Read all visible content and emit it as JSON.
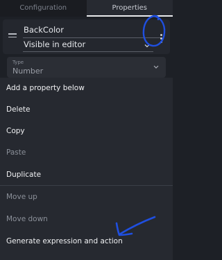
{
  "tabs": [
    {
      "label": "Configuration",
      "active": false
    },
    {
      "label": "Properties",
      "active": true
    }
  ],
  "property": {
    "name": "BackColor",
    "visibility": "Visible in editor",
    "more_icon": "more-vertical-icon"
  },
  "type_field": {
    "label": "Type",
    "value": "Number"
  },
  "menu": {
    "items": [
      {
        "label": "Add a property below",
        "enabled": true
      },
      {
        "label": "Delete",
        "enabled": true
      },
      {
        "label": "Copy",
        "enabled": true
      },
      {
        "label": "Paste",
        "enabled": false
      },
      {
        "label": "Duplicate",
        "enabled": true
      },
      {
        "label": "Move up",
        "enabled": false
      },
      {
        "label": "Move down",
        "enabled": false
      },
      {
        "label": "Generate expression and action",
        "enabled": true
      }
    ]
  },
  "colors": {
    "background": "#1d2026",
    "menu_background": "#262930",
    "annotation": "#1f4fe0"
  }
}
